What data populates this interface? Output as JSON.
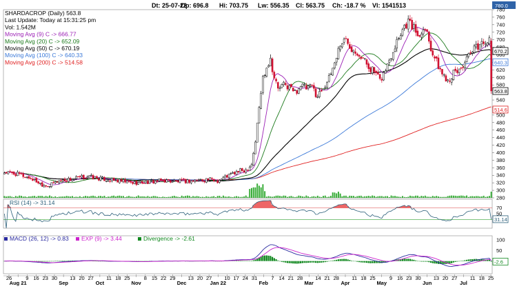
{
  "header": {
    "items": [
      {
        "label": "Dt:",
        "value": "25-07-22"
      },
      {
        "label": "Op:",
        "value": "696.8"
      },
      {
        "label": "Hi:",
        "value": "703.75"
      },
      {
        "label": "Lw:",
        "value": "556.35"
      },
      {
        "label": "Cl:",
        "value": "563.75"
      },
      {
        "label": "Ch:",
        "value": "-18.7 %"
      },
      {
        "label": "Vl:",
        "value": "1541513"
      }
    ],
    "corner_value": "780.0"
  },
  "price_legend": [
    {
      "text": "SHARDACROP (Daily) 563.8",
      "color": "#000000"
    },
    {
      "text": "Last Update: Today at 15:31:25 pm",
      "color": "#000000"
    },
    {
      "text": "Vol: 1.542M",
      "color": "#000000"
    },
    {
      "text": "Moving Avg (9) C -> 666.77",
      "color": "#9b1fb5"
    },
    {
      "text": "Moving Avg (20) C -> 652.09",
      "color": "#1c7a1c"
    },
    {
      "text": "Moving Avg (50) C -> 670.19",
      "color": "#000000"
    },
    {
      "text": "Moving Avg (100) C -> 640.33",
      "color": "#3a78d8"
    },
    {
      "text": "Moving Avg (200) C -> 514.58",
      "color": "#e02020"
    }
  ],
  "rsi_legend": "RSI (14) -> 31.14",
  "macd_legend": {
    "macd": "MACD (26, 12) -> 0.83",
    "exp": "EXP (9) -> 3.44",
    "div": "Divergence -> -2.61"
  },
  "colors": {
    "up": "#000000",
    "down": "#d01030",
    "ma9": "#9b1fb5",
    "ma20": "#1c7a1c",
    "ma50": "#000000",
    "ma100": "#3a78d8",
    "ma200": "#e02020",
    "volume": "#33aa33",
    "rsi": "#2b5f7a",
    "macd": "#2a2aa0",
    "exp": "#cc22cc",
    "divergence": "#11881f"
  },
  "chart_data": [
    {
      "type": "candlestick",
      "title": "SHARDACROP (Daily)",
      "ylim": [
        280,
        780
      ],
      "y_ticks": [
        "780",
        "760",
        "740",
        "720",
        "700",
        "680",
        "660",
        "640",
        "620",
        "600",
        "580",
        "560",
        "540",
        "520",
        "500",
        "480",
        "460",
        "440",
        "420",
        "400",
        "380",
        "360",
        "340",
        "320",
        "300",
        "280"
      ],
      "value_badges": [
        {
          "text": "670.2",
          "value": 670.19,
          "color": "#000000"
        },
        {
          "text": "640.3",
          "value": 640.33,
          "color": "#3a78d8"
        },
        {
          "text": "563.8",
          "value": 563.75,
          "color": "#000000"
        },
        {
          "text": "514.6",
          "value": 514.58,
          "color": "#e02020"
        }
      ],
      "x_ticks": [
        "26",
        "Aug 21",
        "9",
        "16",
        "23",
        "30",
        "Sep",
        "13",
        "20",
        "27",
        "Oct",
        "11",
        "18",
        "25",
        "Nov",
        "8",
        "15",
        "22",
        "29",
        "Dec",
        "13",
        "20",
        "27",
        "Jan 22",
        "10",
        "17",
        "24",
        "31",
        "Feb",
        "7",
        "14",
        "21",
        "28",
        "Mar",
        "14",
        "21",
        "28",
        "Apr",
        "11",
        "18",
        "25",
        "May",
        "9",
        "16",
        "23",
        "30",
        "Jun",
        "13",
        "20",
        "27",
        "Jul",
        "11",
        "18",
        "25"
      ],
      "anchors": [
        {
          "x": 0,
          "close": 348
        },
        {
          "x": 8,
          "close": 342
        },
        {
          "x": 14,
          "close": 332
        },
        {
          "x": 20,
          "close": 316
        },
        {
          "x": 24,
          "close": 312
        },
        {
          "x": 28,
          "close": 325
        },
        {
          "x": 36,
          "close": 330
        },
        {
          "x": 44,
          "close": 337
        },
        {
          "x": 52,
          "close": 330
        },
        {
          "x": 60,
          "close": 325
        },
        {
          "x": 68,
          "close": 320
        },
        {
          "x": 76,
          "close": 322
        },
        {
          "x": 84,
          "close": 326
        },
        {
          "x": 92,
          "close": 324
        },
        {
          "x": 100,
          "close": 325
        },
        {
          "x": 108,
          "close": 330
        },
        {
          "x": 113,
          "close": 325
        },
        {
          "x": 118,
          "close": 338
        },
        {
          "x": 124,
          "close": 350
        },
        {
          "x": 128,
          "close": 355
        },
        {
          "x": 131,
          "close": 370
        },
        {
          "x": 133,
          "close": 430
        },
        {
          "x": 135,
          "close": 520
        },
        {
          "x": 137,
          "close": 600
        },
        {
          "x": 139,
          "close": 630
        },
        {
          "x": 141,
          "close": 650
        },
        {
          "x": 143,
          "close": 600
        },
        {
          "x": 145,
          "close": 570
        },
        {
          "x": 148,
          "close": 580
        },
        {
          "x": 151,
          "close": 575
        },
        {
          "x": 154,
          "close": 560
        },
        {
          "x": 157,
          "close": 580
        },
        {
          "x": 160,
          "close": 570
        },
        {
          "x": 163,
          "close": 575
        },
        {
          "x": 166,
          "close": 550
        },
        {
          "x": 169,
          "close": 575
        },
        {
          "x": 172,
          "close": 595
        },
        {
          "x": 175,
          "close": 640
        },
        {
          "x": 178,
          "close": 690
        },
        {
          "x": 181,
          "close": 700
        },
        {
          "x": 184,
          "close": 680
        },
        {
          "x": 187,
          "close": 670
        },
        {
          "x": 190,
          "close": 650
        },
        {
          "x": 193,
          "close": 630
        },
        {
          "x": 196,
          "close": 615
        },
        {
          "x": 199,
          "close": 590
        },
        {
          "x": 202,
          "close": 620
        },
        {
          "x": 205,
          "close": 660
        },
        {
          "x": 208,
          "close": 700
        },
        {
          "x": 211,
          "close": 730
        },
        {
          "x": 214,
          "close": 750
        },
        {
          "x": 217,
          "close": 730
        },
        {
          "x": 220,
          "close": 710
        },
        {
          "x": 222,
          "close": 740
        },
        {
          "x": 224,
          "close": 720
        },
        {
          "x": 226,
          "close": 680
        },
        {
          "x": 229,
          "close": 640
        },
        {
          "x": 232,
          "close": 610
        },
        {
          "x": 235,
          "close": 595
        },
        {
          "x": 238,
          "close": 610
        },
        {
          "x": 241,
          "close": 620
        },
        {
          "x": 244,
          "close": 640
        },
        {
          "x": 247,
          "close": 660
        },
        {
          "x": 250,
          "close": 680
        },
        {
          "x": 253,
          "close": 690
        },
        {
          "x": 255,
          "close": 700
        },
        {
          "x": 257,
          "close": 695
        },
        {
          "x": 258,
          "close": 564
        }
      ]
    },
    {
      "type": "line",
      "title": "RSI (14)",
      "ylim": [
        0,
        100
      ],
      "y_ticks": [
        "70",
        "50",
        "30"
      ],
      "value_badges": [
        {
          "text": "31.14",
          "value": 31.14,
          "color": "#2b5f7a"
        }
      ],
      "last": 31.14
    },
    {
      "type": "line",
      "title": "MACD (26, 12)",
      "ylim": [
        -60,
        120
      ],
      "y_ticks": [
        "100",
        "50",
        "0"
      ],
      "value_badges": [
        {
          "text": "-2.6",
          "value": -2.61,
          "color": "#11881f"
        }
      ],
      "series": [
        {
          "name": "MACD (26, 12)",
          "last": 0.83
        },
        {
          "name": "EXP (9)",
          "last": 3.44
        },
        {
          "name": "Divergence",
          "last": -2.61
        }
      ]
    }
  ]
}
